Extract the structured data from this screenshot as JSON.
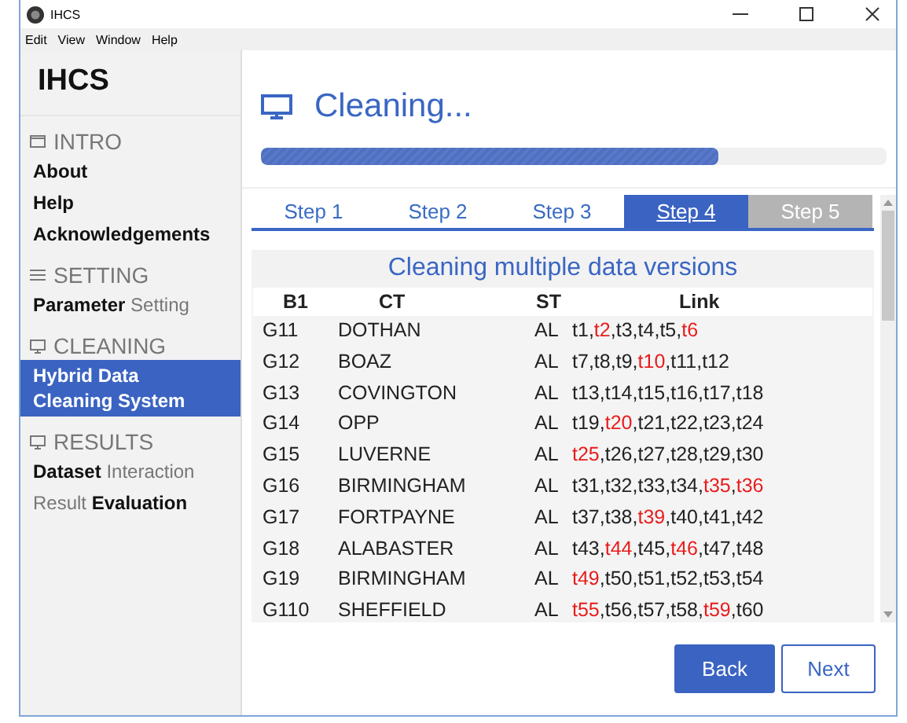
{
  "window": {
    "title": "IHCS"
  },
  "menu": [
    "Edit",
    "View",
    "Window",
    "Help"
  ],
  "sidebar": {
    "title": "IHCS",
    "sections": [
      {
        "label": "INTRO",
        "items": [
          {
            "text": "About",
            "kind": "strong",
            "selected": false
          },
          {
            "text": "Help",
            "kind": "strong",
            "selected": false
          },
          {
            "text": "Acknowledgements",
            "kind": "strong",
            "selected": false
          }
        ]
      },
      {
        "label": "SETTING",
        "items": [
          {
            "text": "**Parameter** Setting",
            "kind": "mixed",
            "selected": false
          }
        ]
      },
      {
        "label": "CLEANING",
        "items": [
          {
            "text": "Hybrid Data Cleaning System",
            "kind": "strong",
            "selected": true
          }
        ]
      },
      {
        "label": "RESULTS",
        "items": [
          {
            "text": "**Dataset** Interaction",
            "kind": "mixed",
            "selected": false
          },
          {
            "text": "Result **Evaluation**",
            "kind": "mixed",
            "selected": false
          }
        ]
      }
    ]
  },
  "header": {
    "title": "Cleaning..."
  },
  "progress": {
    "level": 0.73
  },
  "tabs": [
    {
      "label": "Step 1",
      "selected": false,
      "disabled": false
    },
    {
      "label": "Step 2",
      "selected": false,
      "disabled": false
    },
    {
      "label": "Step 3",
      "selected": false,
      "disabled": false
    },
    {
      "label": "Step 4",
      "selected": true,
      "disabled": false
    },
    {
      "label": "Step 5",
      "selected": false,
      "disabled": true
    }
  ],
  "table": {
    "title": "Cleaning multiple data versions",
    "columns": [
      "B1",
      "CT",
      "ST",
      "Link"
    ],
    "rows": [
      {
        "b1": "G11",
        "ct": "DOTHAN",
        "st": "AL",
        "link": [
          {
            "t": "t1",
            "sep": ",",
            "flagged": false
          },
          {
            "t": "t2",
            "sep": ",",
            "flagged": true
          },
          {
            "t": "t3",
            "sep": ",",
            "flagged": false
          },
          {
            "t": "t4",
            "sep": ",",
            "flagged": false
          },
          {
            "t": "t5",
            "sep": ",",
            "flagged": false
          },
          {
            "t": "t6",
            "flagged": true
          }
        ]
      },
      {
        "b1": "G12",
        "ct": "BOAZ",
        "st": "AL",
        "link": [
          {
            "t": "t7",
            "sep": ",",
            "flagged": false
          },
          {
            "t": "t8",
            "sep": ",",
            "flagged": false
          },
          {
            "t": "t9",
            "sep": ",",
            "flagged": false
          },
          {
            "t": "t10",
            "sep": ",",
            "flagged": true
          },
          {
            "t": "t11",
            "sep": ",",
            "flagged": false
          },
          {
            "t": "t12",
            "flagged": false
          }
        ]
      },
      {
        "b1": "G13",
        "ct": "COVINGTON",
        "st": "AL",
        "link": [
          {
            "t": "t13",
            "sep": ",",
            "flagged": false
          },
          {
            "t": "t14",
            "sep": ",",
            "flagged": false
          },
          {
            "t": "t15",
            "sep": ",",
            "flagged": false
          },
          {
            "t": "t16",
            "sep": ",",
            "flagged": false
          },
          {
            "t": "t17",
            "sep": ",",
            "flagged": false
          },
          {
            "t": "t18",
            "flagged": false
          }
        ]
      },
      {
        "b1": "G14",
        "ct": "OPP",
        "st": "AL",
        "link": [
          {
            "t": "t19",
            "sep": ",",
            "flagged": false
          },
          {
            "t": "t20",
            "sep": ",",
            "flagged": true
          },
          {
            "t": "t21",
            "sep": ",",
            "flagged": false
          },
          {
            "t": "t22",
            "sep": ",",
            "flagged": false
          },
          {
            "t": "t23",
            "sep": ",",
            "flagged": false
          },
          {
            "t": "t24",
            "flagged": false
          }
        ]
      },
      {
        "b1": "G15",
        "ct": "LUVERNE",
        "st": "AL",
        "link": [
          {
            "t": "t25",
            "sep": ",",
            "flagged": true
          },
          {
            "t": "t26",
            "sep": ",",
            "flagged": false
          },
          {
            "t": "t27",
            "sep": ",",
            "flagged": false
          },
          {
            "t": "t28",
            "sep": ",",
            "flagged": false
          },
          {
            "t": "t29",
            "sep": ",",
            "flagged": false
          },
          {
            "t": "t30",
            "flagged": false
          }
        ]
      },
      {
        "b1": "G16",
        "ct": "BIRMINGHAM",
        "st": "AL",
        "link": [
          {
            "t": "t31",
            "sep": ",",
            "flagged": false
          },
          {
            "t": "t32",
            "sep": ",",
            "flagged": false
          },
          {
            "t": "t33",
            "sep": ",",
            "flagged": false
          },
          {
            "t": "t34",
            "sep": ",",
            "flagged": false
          },
          {
            "t": "t35",
            "sep": ",",
            "flagged": true
          },
          {
            "t": "t36",
            "flagged": true
          }
        ]
      },
      {
        "b1": "G17",
        "ct": "FORTPAYNE",
        "st": "AL",
        "link": [
          {
            "t": "t37",
            "sep": ",",
            "flagged": false
          },
          {
            "t": "t38",
            "sep": ",",
            "flagged": false
          },
          {
            "t": "t39",
            "sep": ",",
            "flagged": true
          },
          {
            "t": "t40",
            "sep": ",",
            "flagged": false
          },
          {
            "t": "t41",
            "sep": ",",
            "flagged": false
          },
          {
            "t": "t42",
            "flagged": false
          }
        ]
      },
      {
        "b1": "G18",
        "ct": "ALABASTER",
        "st": "AL",
        "link": [
          {
            "t": "t43",
            "sep": ",",
            "flagged": false
          },
          {
            "t": "t44",
            "sep": ",",
            "flagged": true
          },
          {
            "t": "t45",
            "sep": ",",
            "flagged": false
          },
          {
            "t": "t46",
            "sep": ",",
            "flagged": true
          },
          {
            "t": "t47",
            "sep": ",",
            "flagged": false
          },
          {
            "t": "t48",
            "flagged": false
          }
        ]
      },
      {
        "b1": "G19",
        "ct": "BIRMINGHAM",
        "st": "AL",
        "link": [
          {
            "t": "t49",
            "sep": ",",
            "flagged": true
          },
          {
            "t": "t50",
            "sep": ",",
            "flagged": false
          },
          {
            "t": "t51",
            "sep": ",",
            "flagged": false
          },
          {
            "t": "t52",
            "sep": ",",
            "flagged": false
          },
          {
            "t": "t53",
            "sep": ",",
            "flagged": false
          },
          {
            "t": "t54",
            "flagged": false
          }
        ]
      },
      {
        "b1": "G110",
        "ct": "SHEFFIELD",
        "st": "AL",
        "link": [
          {
            "t": "t55",
            "sep": ",",
            "flagged": true
          },
          {
            "t": "t56",
            "sep": ",",
            "flagged": false
          },
          {
            "t": "t57",
            "sep": ",",
            "flagged": false
          },
          {
            "t": "t58",
            "sep": ",",
            "flagged": false
          },
          {
            "t": "t59",
            "sep": ",",
            "flagged": true
          },
          {
            "t": "t60",
            "flagged": false
          }
        ]
      }
    ]
  },
  "buttons": [
    {
      "label": "Back",
      "kind": "primary"
    },
    {
      "label": "Next",
      "kind": "secondary"
    }
  ]
}
